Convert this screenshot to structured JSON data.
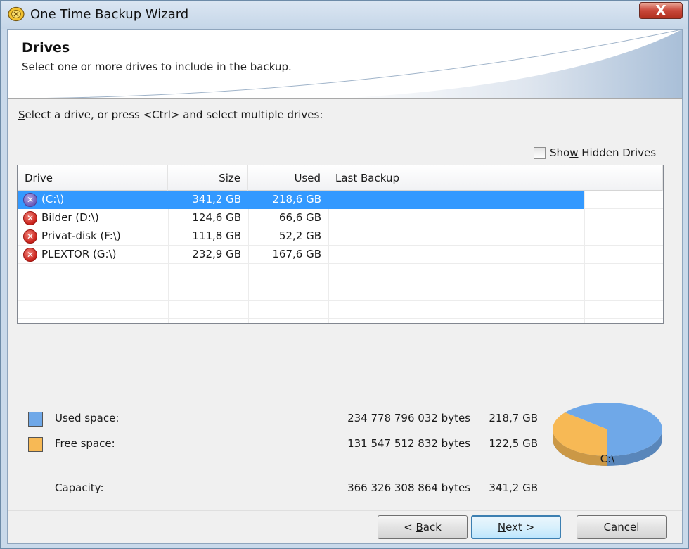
{
  "window": {
    "title": "One Time Backup Wizard",
    "close_label": "X"
  },
  "header": {
    "title": "Drives",
    "subtitle": "Select one or more drives to include in the backup."
  },
  "instruction": {
    "underlined_letter": "S",
    "rest": "elect a drive, or press <Ctrl> and select multiple drives:"
  },
  "hidden_drives": {
    "label_before": "Sho",
    "underlined_letter": "w",
    "label_after": " Hidden Drives",
    "checked": false
  },
  "table": {
    "columns": [
      "Drive",
      "Size",
      "Used",
      "Last Backup"
    ],
    "rows": [
      {
        "drive": "(C:\\)",
        "size": "341,2 GB",
        "used": "218,6 GB",
        "last_backup": "",
        "icon": "drive-status-icon",
        "selected": true
      },
      {
        "drive": "Bilder (D:\\)",
        "size": "124,6 GB",
        "used": "66,6 GB",
        "last_backup": "",
        "icon": "drive-status-icon",
        "selected": false
      },
      {
        "drive": "Privat-disk (F:\\)",
        "size": "111,8 GB",
        "used": "52,2 GB",
        "last_backup": "",
        "icon": "drive-status-icon",
        "selected": false
      },
      {
        "drive": "PLEXTOR (G:\\)",
        "size": "232,9 GB",
        "used": "167,6 GB",
        "last_backup": "",
        "icon": "drive-status-icon",
        "selected": false
      }
    ]
  },
  "summary": {
    "used": {
      "label": "Used space:",
      "bytes": "234 778 796 032 bytes",
      "gb": "218,7 GB",
      "color": "#6fa8e8"
    },
    "free": {
      "label": "Free space:",
      "bytes": "131 547 512 832 bytes",
      "gb": "122,5 GB",
      "color": "#f7b955"
    },
    "capacity": {
      "label": "Capacity:",
      "bytes": "366 326 308 864 bytes",
      "gb": "341,2 GB"
    }
  },
  "pie": {
    "label": "C:\\",
    "used_fraction": 0.641,
    "free_fraction": 0.359
  },
  "buttons": {
    "back": {
      "prefix": "< ",
      "underlined": "B",
      "rest": "ack"
    },
    "next": {
      "underlined": "N",
      "rest": "ext >"
    },
    "cancel": "Cancel"
  }
}
